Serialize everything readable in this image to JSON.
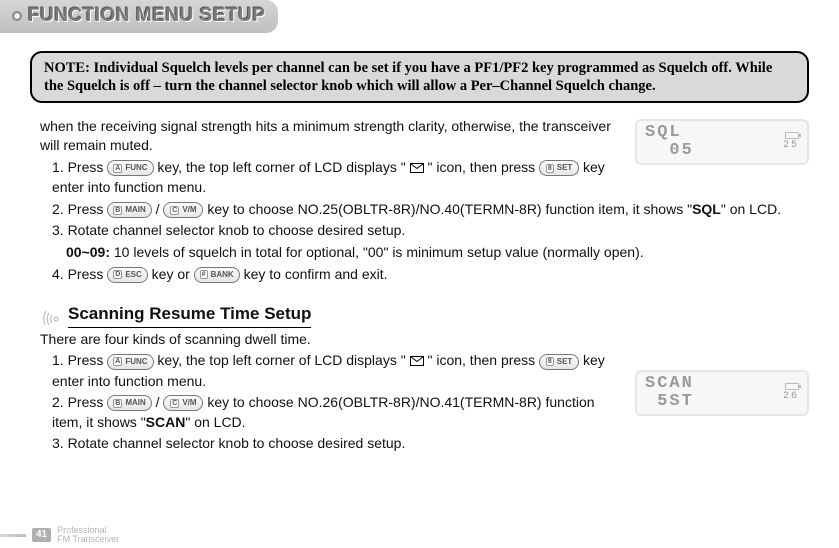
{
  "header": {
    "title": "FUNCTION MENU SETUP"
  },
  "note": {
    "prefix": "NOTE:",
    "text": "Individual Squelch levels per channel can be set if you have a PF1/PF2 key programmed as Squelch off. While the Squelch is off – turn the channel selector knob which will allow a Per–Channel Squelch change."
  },
  "section1": {
    "intro": "when the receiving signal strength hits a minimum strength clarity, otherwise, the transceiver will remain muted.",
    "steps": {
      "s1a": "1. Press ",
      "s1b": " key, the top left corner of LCD displays \" ",
      "s1c": " \" icon, then press ",
      "s1d": " key enter into function menu.",
      "s2a": "2. Press ",
      "s2b": " / ",
      "s2c": " key to choose NO.25(OBLTR-8R)/NO.40(TERMN-8R) function item, it shows \"",
      "s2d": "\" on LCD.",
      "s3": "3. Rotate channel selector knob to choose desired setup.",
      "s3sub_a": "00~09:",
      "s3sub_b": " 10 levels of squelch in total for optional, \"00\" is minimum setup value (normally open).",
      "s4a": "4. Press ",
      "s4b": " key or ",
      "s4c": " key to confirm and exit."
    },
    "sql_word": "SQL",
    "lcd": {
      "main": "SQL\n  05",
      "num": "25"
    }
  },
  "section2": {
    "title": "Scanning Resume Time Setup",
    "intro": "There are four kinds of scanning dwell time.",
    "steps": {
      "s1a": "1. Press ",
      "s1b": " key, the top left corner of LCD displays \" ",
      "s1c": " \" icon, then press ",
      "s1d": " key enter into function menu.",
      "s2a": "2. Press ",
      "s2b": " / ",
      "s2c": " key to choose NO.26(OBLTR-8R)/NO.41(TERMN-8R) function item, it shows \"",
      "s2d": "\" on LCD.",
      "s3": "3. Rotate channel selector knob to choose desired setup."
    },
    "scan_word": "SCAN",
    "lcd": {
      "main": "SCAN\n 5ST",
      "num": "26"
    }
  },
  "keys": {
    "a_func": {
      "sup": "A",
      "label": "FUNC"
    },
    "b_main": {
      "sup": "B",
      "label": "MAIN"
    },
    "c_vm": {
      "sup": "C",
      "label": "V/M"
    },
    "d_esc": {
      "sup": "D",
      "label": "ESC"
    },
    "8_set": {
      "sup": "8",
      "label": "SET"
    },
    "hash_bank": {
      "sup": "#",
      "label": "BANK"
    }
  },
  "footer": {
    "page": "41",
    "line1": "Professional",
    "line2": "FM Transceiver"
  }
}
